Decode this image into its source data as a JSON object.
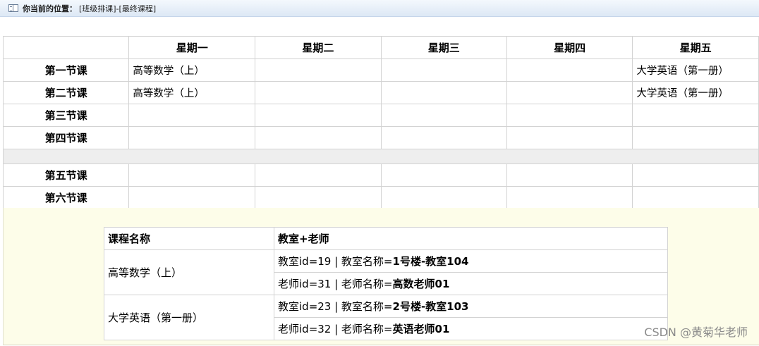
{
  "breadcrumb": {
    "label": "你当前的位置：",
    "value": "[班级排课]-[最终课程]",
    "icon": "book-icon"
  },
  "schedule": {
    "days": [
      "星期一",
      "星期二",
      "星期三",
      "星期四",
      "星期五"
    ],
    "rows_am": [
      {
        "period": "第一节课",
        "cells": [
          "高等数学（上）",
          "",
          "",
          "",
          "大学英语（第一册）"
        ]
      },
      {
        "period": "第二节课",
        "cells": [
          "高等数学（上）",
          "",
          "",
          "",
          "大学英语（第一册）"
        ]
      },
      {
        "period": "第三节课",
        "cells": [
          "",
          "",
          "",
          "",
          ""
        ]
      },
      {
        "period": "第四节课",
        "cells": [
          "",
          "",
          "",
          "",
          ""
        ]
      }
    ],
    "rows_pm": [
      {
        "period": "第五节课",
        "cells": [
          "",
          "",
          "",
          "",
          ""
        ]
      },
      {
        "period": "第六节课",
        "cells": [
          "",
          "",
          "",
          "",
          ""
        ]
      }
    ]
  },
  "details": {
    "headers": [
      "课程名称",
      "教室+老师"
    ],
    "courses": [
      {
        "name": "高等数学（上）",
        "room_prefix": "教室id=19 | 教室名称=",
        "room_name": "1号楼-教室104",
        "teacher_prefix": "老师id=31 | 老师名称=",
        "teacher_name": "高数老师01"
      },
      {
        "name": "大学英语（第一册）",
        "room_prefix": "教室id=23 | 教室名称=",
        "room_name": "2号楼-教室103",
        "teacher_prefix": "老师id=32 | 老师名称=",
        "teacher_name": "英语老师01"
      }
    ]
  },
  "watermark": "CSDN @黄菊华老师"
}
